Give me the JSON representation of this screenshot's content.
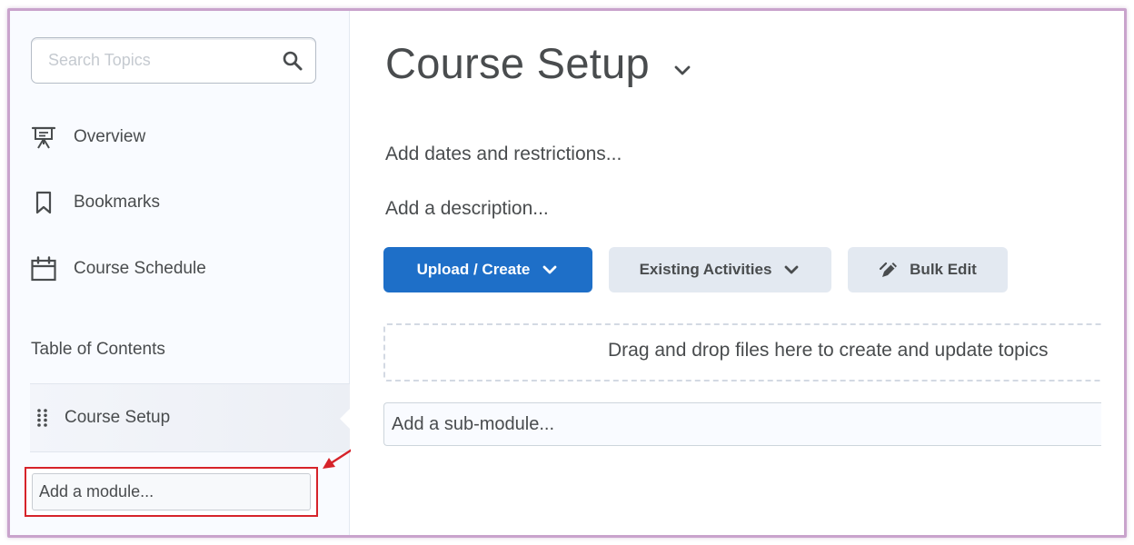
{
  "sidebar": {
    "search": {
      "placeholder": "Search Topics",
      "value": ""
    },
    "items": [
      {
        "label": "Overview",
        "icon": "presentation-board-icon"
      },
      {
        "label": "Bookmarks",
        "icon": "bookmark-icon"
      },
      {
        "label": "Course Schedule",
        "icon": "calendar-icon"
      }
    ],
    "toc_heading": "Table of Contents",
    "modules": [
      {
        "label": "Course Setup",
        "icon": "drag-grip-icon"
      }
    ],
    "add_module_placeholder": "Add a module..."
  },
  "main": {
    "title": "Course Setup",
    "add_dates": "Add dates and restrictions...",
    "add_description": "Add a description...",
    "buttons": {
      "upload_create": "Upload / Create",
      "existing_activities": "Existing Activities",
      "bulk_edit": "Bulk Edit"
    },
    "dropzone_text": "Drag and drop files here to create and update topics",
    "add_submodule_placeholder": "Add a sub-module..."
  },
  "colors": {
    "primary_button": "#1e6fc8",
    "secondary_button": "#e3e9f1",
    "highlight_box": "#d6232a",
    "frame_border": "#c9a3cc",
    "text": "#494c4e"
  }
}
